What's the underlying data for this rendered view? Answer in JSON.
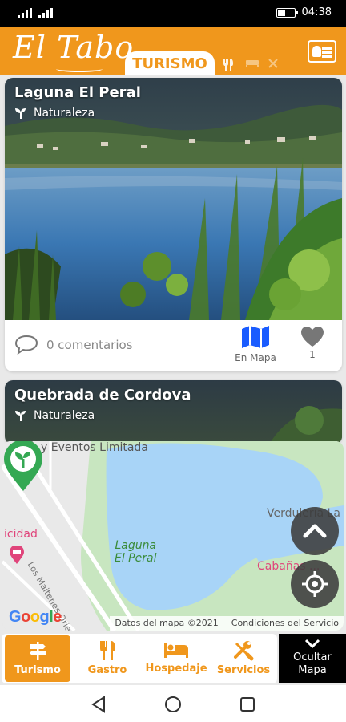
{
  "status_bar": {
    "time": "04:38",
    "battery_fraction": 0.45
  },
  "header": {
    "logo": "El Tabo",
    "tabs": [
      {
        "label": "TURISMO",
        "icon": "tourism-tab",
        "active": true
      },
      {
        "label": "",
        "icon": "fork-knife-icon",
        "active": false
      },
      {
        "label": "",
        "icon": "bed-icon",
        "active": false
      },
      {
        "label": "",
        "icon": "tools-icon",
        "active": false
      }
    ],
    "profile_icon": "id-card-icon"
  },
  "cards": [
    {
      "title": "Laguna El Peral",
      "category": "Naturaleza",
      "category_icon": "sprout-icon",
      "comments": "0 comentarios",
      "map_label": "En Mapa",
      "likes": "1"
    },
    {
      "title": "Quebrada de Cordova",
      "category": "Naturaleza",
      "category_icon": "sprout-icon"
    }
  ],
  "map": {
    "top_label": "y Eventos Limitada",
    "lake_label_1": "Laguna",
    "lake_label_2": "El Peral",
    "verduleria": "Verdulería La",
    "cabanas": "Cabañas ...",
    "icidad": "icidad",
    "street": "Los Maitenes Oriente",
    "google": [
      "G",
      "o",
      "o",
      "g",
      "l",
      "e"
    ],
    "attribution": "Datos del mapa ©2021",
    "terms": "Condiciones del Servicio"
  },
  "bottom_nav": [
    {
      "label": "Turismo",
      "icon": "signpost-icon",
      "active": true
    },
    {
      "label": "Gastro",
      "icon": "fork-knife-icon",
      "active": false
    },
    {
      "label": "Hospedaje",
      "icon": "bed-icon",
      "active": false
    },
    {
      "label": "Servicios",
      "icon": "tools-icon",
      "active": false
    }
  ],
  "hide_map": {
    "line1": "Ocultar",
    "line2": "Mapa"
  },
  "colors": {
    "brand": "#f0971c",
    "map_water": "#a8d4f7",
    "map_green": "#c8e6c0",
    "pin": "#34a853",
    "map_icon": "#1a5cff"
  }
}
